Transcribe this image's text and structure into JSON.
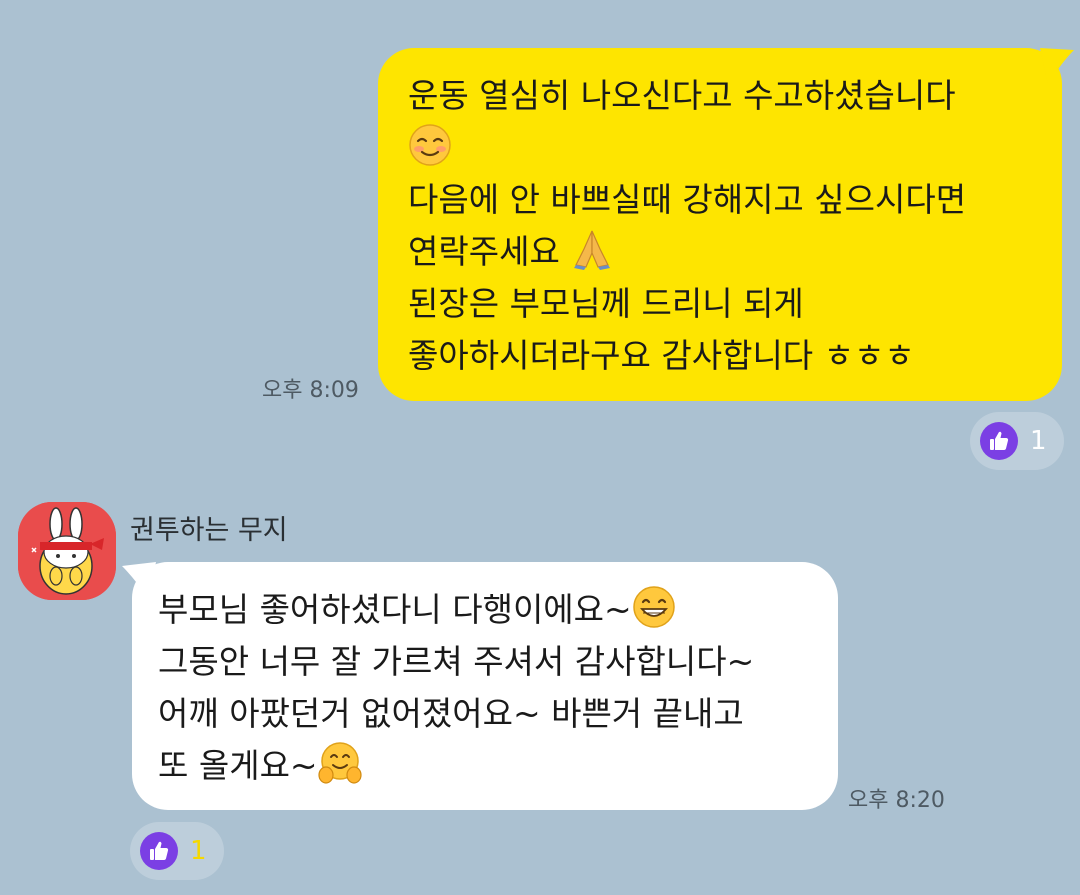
{
  "messages": [
    {
      "direction": "outgoing",
      "lines": [
        "운동 열심히 나오신다고 수고하셨습니다",
        "",
        "다음에 안 바쁘실때 강해지고 싶으시다면",
        "연락주세요",
        "된장은 부모님께 드리니 되게",
        "좋아하시더라구요 감사합니다 ㅎㅎㅎ"
      ],
      "emojis": [
        "smiling-blush-emoji",
        "folded-hands-emoji"
      ],
      "time": "오후 8:09",
      "reaction": {
        "icon": "thumbs-up-icon",
        "count": "1",
        "color": "#7b3fe4"
      },
      "bubble_color": "#fee500"
    },
    {
      "direction": "incoming",
      "sender": "권투하는 무지",
      "lines": [
        "부모님 좋어하셨다니 다행이에요~",
        "그동안 너무 잘 가르쳐 주셔서 감사합니다~",
        "어깨 아팠던거 없어졌어요~ 바쁜거 끝내고",
        "또 올게요~"
      ],
      "emojis": [
        "grinning-emoji",
        "hugging-face-emoji"
      ],
      "time": "오후 8:20",
      "reaction": {
        "icon": "thumbs-up-icon",
        "count": "1",
        "color": "#7b3fe4"
      },
      "bubble_color": "#ffffff"
    }
  ],
  "background_color": "#abc1d1"
}
